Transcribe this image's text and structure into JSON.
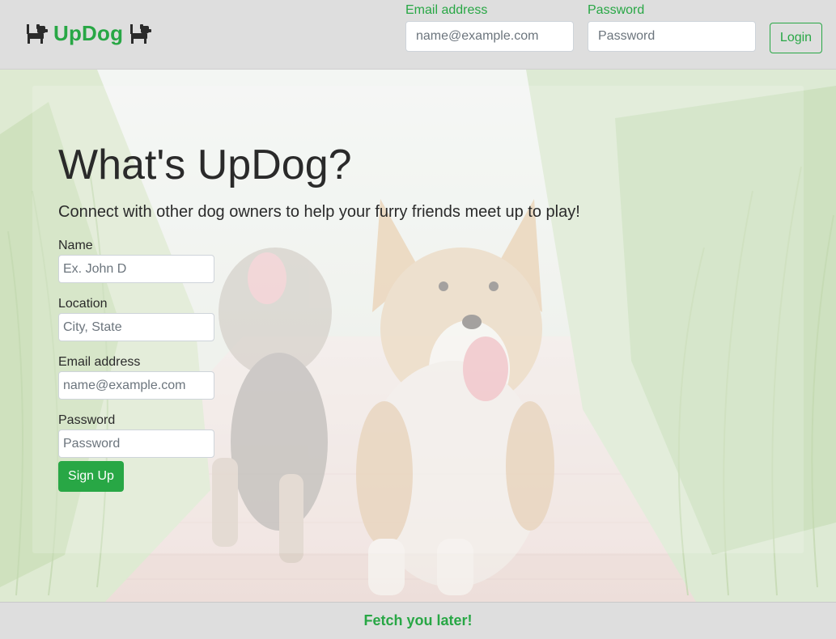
{
  "brand": {
    "name": "UpDog",
    "icon": "dog-icon"
  },
  "nav_login": {
    "email_label": "Email address",
    "email_placeholder": "name@example.com",
    "email_value": "",
    "password_label": "Password",
    "password_placeholder": "Password",
    "password_value": "",
    "login_button": "Login"
  },
  "hero": {
    "title": "What's UpDog?",
    "lead": "Connect with other dog owners to help your furry friends meet up to play!",
    "background": "photo-two-dogs-walking-on-brick-path-through-grass"
  },
  "signup": {
    "name_label": "Name",
    "name_placeholder": "Ex. John D",
    "location_label": "Location",
    "location_placeholder": "City, State",
    "email_label": "Email address",
    "email_placeholder": "name@example.com",
    "password_label": "Password",
    "password_placeholder": "Password",
    "submit_button": "Sign Up"
  },
  "footer": {
    "text": "Fetch you later!"
  },
  "colors": {
    "accent": "#28a745",
    "navbar_bg": "#dedede"
  }
}
